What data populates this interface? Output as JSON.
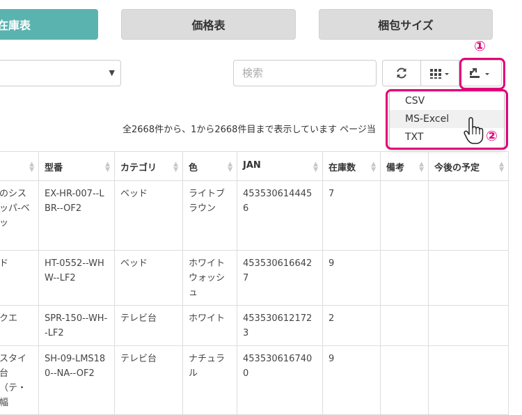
{
  "tabs": [
    {
      "label": "在庫表",
      "active": true
    },
    {
      "label": "価格表",
      "active": false
    },
    {
      "label": "梱包サイズ",
      "active": false
    }
  ],
  "search": {
    "placeholder": "検索"
  },
  "markers": {
    "one": "①",
    "two": "②"
  },
  "export_menu": {
    "items": [
      "CSV",
      "MS-Excel",
      "TXT"
    ],
    "hovered": "MS-Excel"
  },
  "info_text": "全2668件から、1から2668件目まで表示しています ページ当",
  "table": {
    "headers": [
      "",
      "型番",
      "カテゴリ",
      "色",
      "JAN",
      "在庫数",
      "備考",
      "今後の予定"
    ],
    "rows": [
      [
        "のシスッパ-ベッ",
        "EX-HR-007--LBR--OF2",
        "ベッド",
        "ライトブラウン",
        "4535306144456",
        "7",
        "",
        ""
      ],
      [
        "ド",
        "HT-0552--WHW--LF2",
        "ベッド",
        "ホワイトウォッシュ",
        "4535306166427",
        "9",
        "",
        ""
      ],
      [
        "クエ",
        "SPR-150--WH--LF2",
        "テレビ台",
        "ホワイト",
        "4535306121723",
        "2",
        "",
        ""
      ],
      [
        "スタイ台（テ・幅",
        "SH-09-LMS180--NA--OF2",
        "テレビ台",
        "ナチュラル",
        "4535306167400",
        "9",
        "",
        ""
      ]
    ]
  },
  "colors": {
    "accent": "#5bb3b0",
    "highlight": "#e2007a"
  }
}
